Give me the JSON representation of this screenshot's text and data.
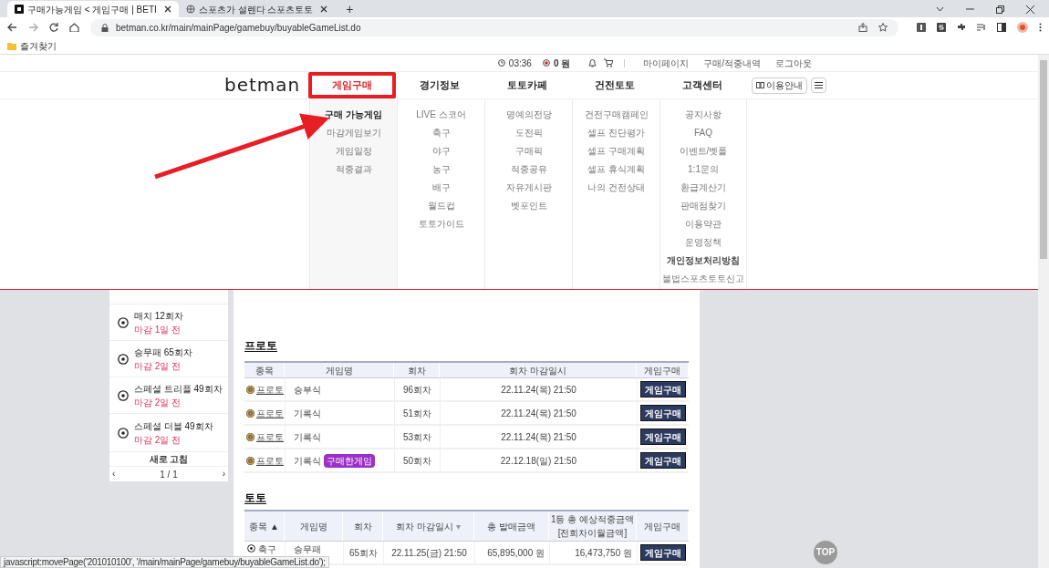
{
  "browser": {
    "tabs": [
      {
        "title": "구매가능게임 < 게임구매 | BETI",
        "selected": true
      },
      {
        "title": "스포츠가 설렌다 스포츠토토",
        "selected": false
      }
    ],
    "new_tab": "+",
    "url": "betman.co.kr/main/mainPage/gamebuy/buyableGameList.do",
    "bookmark": "즐겨찾기"
  },
  "utility": {
    "time": "03:36",
    "points": "0 원",
    "links": [
      "마이페이지",
      "구매/적중내역",
      "로그아웃"
    ]
  },
  "logo": "betman",
  "nav": [
    {
      "label": "게임구매",
      "selected": true
    },
    {
      "label": "경기정보",
      "selected": false
    },
    {
      "label": "토토카페",
      "selected": false
    },
    {
      "label": "건전토토",
      "selected": false
    },
    {
      "label": "고객센터",
      "selected": false
    }
  ],
  "guide_button": "이용안내",
  "mega_menu": [
    {
      "items": [
        {
          "label": "구매 가능게임",
          "selected": true,
          "emphasized": false
        },
        {
          "label": "마감게임보기",
          "selected": false,
          "emphasized": false
        },
        {
          "label": "게임일정",
          "selected": false,
          "emphasized": false
        },
        {
          "label": "적중결과",
          "selected": false,
          "emphasized": false
        }
      ]
    },
    {
      "items": [
        {
          "label": "LIVE 스코어",
          "selected": false,
          "emphasized": false
        },
        {
          "label": "축구",
          "selected": false,
          "emphasized": false
        },
        {
          "label": "야구",
          "selected": false,
          "emphasized": false
        },
        {
          "label": "농구",
          "selected": false,
          "emphasized": false
        },
        {
          "label": "배구",
          "selected": false,
          "emphasized": false
        },
        {
          "label": "월드컵",
          "selected": false,
          "emphasized": false
        },
        {
          "label": "토토가이드",
          "selected": false,
          "emphasized": false
        }
      ]
    },
    {
      "items": [
        {
          "label": "명예의전당",
          "selected": false,
          "emphasized": false
        },
        {
          "label": "도전픽",
          "selected": false,
          "emphasized": false
        },
        {
          "label": "구매픽",
          "selected": false,
          "emphasized": false
        },
        {
          "label": "적중공유",
          "selected": false,
          "emphasized": false
        },
        {
          "label": "자유게시판",
          "selected": false,
          "emphasized": false
        },
        {
          "label": "벳포인트",
          "selected": false,
          "emphasized": false
        }
      ]
    },
    {
      "items": [
        {
          "label": "건전구매캠페인",
          "selected": false,
          "emphasized": false
        },
        {
          "label": "셀프 진단평가",
          "selected": false,
          "emphasized": false
        },
        {
          "label": "셀프 구매계획",
          "selected": false,
          "emphasized": false
        },
        {
          "label": "셀프 휴식계획",
          "selected": false,
          "emphasized": false
        },
        {
          "label": "나의 건전상태",
          "selected": false,
          "emphasized": false
        }
      ]
    },
    {
      "items": [
        {
          "label": "공지사항",
          "selected": false,
          "emphasized": false
        },
        {
          "label": "FAQ",
          "selected": false,
          "emphasized": false
        },
        {
          "label": "이벤트/벳폴",
          "selected": false,
          "emphasized": false
        },
        {
          "label": "1:1문의",
          "selected": false,
          "emphasized": false
        },
        {
          "label": "환급계산기",
          "selected": false,
          "emphasized": false
        },
        {
          "label": "판매점찾기",
          "selected": false,
          "emphasized": false
        },
        {
          "label": "이용약관",
          "selected": false,
          "emphasized": false
        },
        {
          "label": "운영정책",
          "selected": false,
          "emphasized": false
        },
        {
          "label": "개인정보처리방침",
          "selected": false,
          "emphasized": true
        },
        {
          "label": "불법스포츠토토신고",
          "selected": false,
          "emphasized": false
        }
      ]
    }
  ],
  "sidebar": {
    "items": [
      {
        "title": "매치 12회차",
        "subtitle": "마감 1일 전"
      },
      {
        "title": "승무패 65회차",
        "subtitle": "마감 2일 전"
      },
      {
        "title": "스페셜 트리플 49회차",
        "subtitle": "마감 2일 전"
      },
      {
        "title": "스페셜 더블 49회차",
        "subtitle": "마감 2일 전"
      }
    ],
    "refresh": "새로 고침",
    "prev": "‹",
    "page": "1 / 1",
    "next": "›"
  },
  "proto": {
    "title": "프로토",
    "columns": [
      "종목",
      "게임명",
      "회차",
      "회차 마감일시",
      "게임구매"
    ],
    "rows": [
      {
        "sport": "프로토",
        "name": "승부식",
        "round": "96회차",
        "deadline": "22.11.24(목) 21:50",
        "button": "게임구매"
      },
      {
        "sport": "프로토",
        "name": "기록식",
        "round": "51회차",
        "deadline": "22.11.24(목) 21:50",
        "button": "게임구매"
      },
      {
        "sport": "프로토",
        "name": "기록식",
        "round": "53회차",
        "deadline": "22.11.24(목) 21:50",
        "button": "게임구매"
      },
      {
        "sport": "프로토",
        "name": "기록식",
        "badge": "구매한게임",
        "round": "50회차",
        "deadline": "22.12.18(일) 21:50",
        "button": "게임구매"
      }
    ]
  },
  "toto": {
    "title": "토토",
    "columns": [
      {
        "label": "종목",
        "sort": "▲"
      },
      {
        "label": "게임명"
      },
      {
        "label": "회차"
      },
      {
        "label": "회차 마감일시",
        "sort": "▾"
      },
      {
        "label": "총 발매금액"
      },
      {
        "label": "1등 총 예상적중금액",
        "sub": "[전회차이월금액]"
      },
      {
        "label": "게임구매"
      }
    ],
    "rows": [
      {
        "sport": "축구",
        "name": "승무패",
        "round": "65회차",
        "deadline": "22.11.25(금) 21:50",
        "sales": "65,895,000 원",
        "prize": "16,473,750 원",
        "button": "게임구매"
      }
    ]
  },
  "top_button": "TOP",
  "status_bar": "javascript:movePage('201010100', '/main/mainPage/gamebuy/buyableGameList.do');"
}
